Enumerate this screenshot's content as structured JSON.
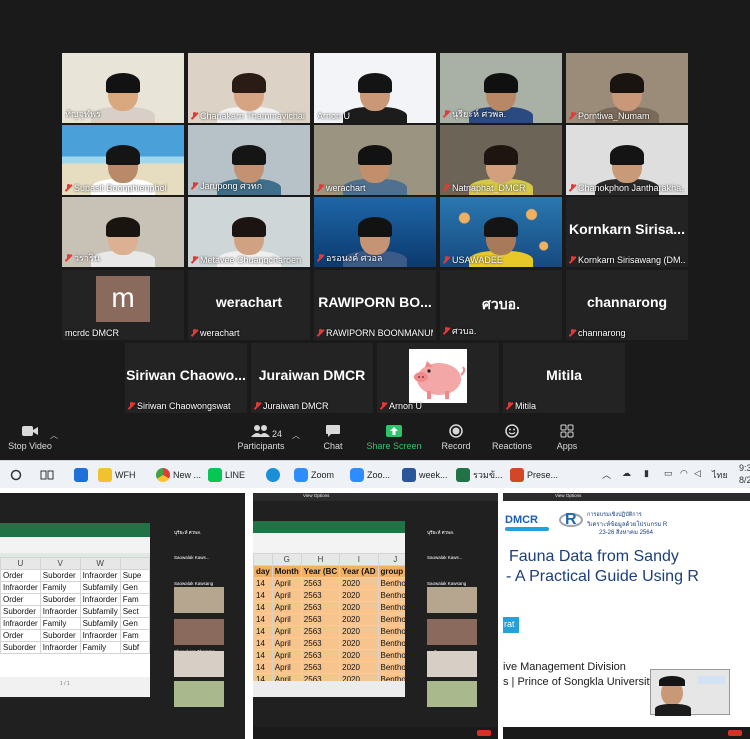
{
  "gallery": {
    "tiles": [
      {
        "name": "ทัญจุฬพร",
        "muted": false,
        "kind": "video",
        "bg": "#e9e4d8",
        "skin": "#d9a87f",
        "hair": "#121212",
        "shirt": "#d8d0c8"
      },
      {
        "name": "Chanakarn Thammavichai",
        "muted": true,
        "kind": "video",
        "bg": "#dcd3c6",
        "skin": "#d6a483",
        "hair": "#2a1c14",
        "shirt": "#f2f2f2"
      },
      {
        "name": "Arnon U",
        "muted": false,
        "kind": "video",
        "bg": "#f2f4f7",
        "skin": "#c99977",
        "hair": "#141414",
        "shirt": "#1c1c1c"
      },
      {
        "name": "นุรียะห์ ศวพล.",
        "muted": true,
        "kind": "video",
        "bg": "#a9b0a6",
        "skin": "#b88866",
        "hair": "#101010",
        "shirt": "#2a4a80"
      },
      {
        "name": "Porntiwa_Numam",
        "muted": true,
        "kind": "video",
        "bg": "#9b8b79",
        "skin": "#c89878",
        "hair": "#1a1410",
        "shirt": "#7a6a5a"
      },
      {
        "name": "Supasit Boonphienphol",
        "muted": true,
        "kind": "beach",
        "bg": "#4aa0d8",
        "skin": "#b88a6a",
        "hair": "#151515",
        "shirt": "#ffffff"
      },
      {
        "name": "Jarupong ศวทก",
        "muted": true,
        "kind": "video",
        "bg": "#b7c2c8",
        "skin": "#c39272",
        "hair": "#151515",
        "shirt": "#3f6f8a"
      },
      {
        "name": "werachart",
        "muted": true,
        "kind": "video",
        "bg": "#9a9480",
        "skin": "#c28f6c",
        "hair": "#121212",
        "shirt": "#507090"
      },
      {
        "name": "Natnaphat_DMCR",
        "muted": true,
        "kind": "video",
        "bg": "#6d6458",
        "skin": "#d2a07c",
        "hair": "#1e1510",
        "shirt": "#d4c84a"
      },
      {
        "name": "Chanokphon Jantharakha...",
        "muted": true,
        "kind": "video",
        "bg": "#dedede",
        "skin": "#c89a78",
        "hair": "#141414",
        "shirt": "#2a2a2a"
      },
      {
        "name": "วราริน",
        "muted": true,
        "kind": "video",
        "bg": "#c7c1b6",
        "skin": "#dcb093",
        "hair": "#1a1410",
        "shirt": "#e8e8e8"
      },
      {
        "name": "Metavee Chuangcharoen",
        "muted": true,
        "kind": "video",
        "bg": "#cfd6d8",
        "skin": "#d1a282",
        "hair": "#1c1410",
        "shirt": "#f0f0f0"
      },
      {
        "name": "อรอนงค์ ศวอล",
        "muted": true,
        "kind": "reef",
        "bg": "#1f66a8",
        "skin": "#c49474",
        "hair": "#121212",
        "shirt": "#3c5a88"
      },
      {
        "name": "USAWADEE",
        "muted": true,
        "kind": "jelly",
        "bg": "#2a77b0",
        "skin": "#a87a5a",
        "hair": "#141414",
        "shirt": "#e8c828"
      },
      {
        "name": "Kornkarn Sirisawang (DM...",
        "muted": true,
        "kind": "text",
        "text": "Kornkarn  Sirisa..."
      },
      {
        "name": "mcrdc DMCR",
        "muted": false,
        "kind": "avatar",
        "letter": "m"
      },
      {
        "name": "werachart",
        "muted": true,
        "kind": "text",
        "text": "werachart"
      },
      {
        "name": "RAWIPORN BOONMANUM",
        "muted": true,
        "kind": "text",
        "text": "RAWIPORN  BO..."
      },
      {
        "name": "ศวบอ.",
        "muted": true,
        "kind": "text",
        "text": "ศวบอ."
      },
      {
        "name": "channarong",
        "muted": true,
        "kind": "text",
        "text": "channarong"
      },
      {
        "name": "Siriwan Chaowongswat",
        "muted": true,
        "kind": "text",
        "text": "Siriwan  Chaowo..."
      },
      {
        "name": "Juraiwan DMCR",
        "muted": true,
        "kind": "text",
        "text": "Juraiwan DMCR"
      },
      {
        "name": "Arnon U",
        "muted": true,
        "kind": "pig"
      },
      {
        "name": "Mitila",
        "muted": true,
        "kind": "text",
        "text": "Mitila"
      }
    ]
  },
  "toolbar": {
    "stop_video": "Stop Video",
    "participants": "Participants",
    "participants_count": "24",
    "chat": "Chat",
    "share_screen": "Share Screen",
    "record": "Record",
    "reactions": "Reactions",
    "apps": "Apps"
  },
  "taskbar": {
    "items": [
      "WFH",
      "New ...",
      "LINE",
      "Zoom",
      "Zoo...",
      "week...",
      "รวมข้...",
      "Prese..."
    ],
    "lang": "ไทย",
    "clock_time": "9:3",
    "clock_date": "8/2"
  },
  "panel1": {
    "columns": [
      "U",
      "V",
      "W"
    ],
    "rows": [
      [
        "Order",
        "Suborder",
        "Infraorder",
        "Supe"
      ],
      [
        "Infraorder",
        "Family",
        "Subfamily",
        "Gen"
      ],
      [
        "Order",
        "Suborder",
        "Infraorder",
        "Fam"
      ],
      [
        "Suborder",
        "Infraorder",
        "Subfamily",
        "Sect"
      ],
      [
        "Infraorder",
        "Family",
        "Subfamily",
        "Gen"
      ],
      [
        "Order",
        "Suborder",
        "Infraorder",
        "Fam"
      ],
      [
        "Suborder",
        "Infraorder",
        "Family",
        "Subf"
      ]
    ],
    "side_names": [
      "นุรียะห์ ศวพล.",
      "Saowalak Kaws...",
      "Saowalak Kawsang",
      "mcrdc DMCR",
      "Chanakarn Thamma..."
    ]
  },
  "panel2": {
    "columns": [
      "G",
      "H",
      "I",
      "J",
      "K"
    ],
    "headers": [
      "day",
      "Month",
      "Year (BC",
      "Year (AD",
      "group",
      "Kin"
    ],
    "rows": [
      [
        "14",
        "April",
        "2563",
        "2020",
        "Benthos",
        "Ani"
      ],
      [
        "14",
        "April",
        "2563",
        "2020",
        "Benthos",
        "Ani"
      ],
      [
        "14",
        "April",
        "2563",
        "2020",
        "Benthos",
        "Ani"
      ],
      [
        "14",
        "April",
        "2563",
        "2020",
        "Benthos",
        "Ani"
      ],
      [
        "14",
        "April",
        "2563",
        "2020",
        "Benthos",
        "Ani"
      ],
      [
        "14",
        "April",
        "2563",
        "2020",
        "Benthos",
        "Ani"
      ],
      [
        "14",
        "April",
        "2563",
        "2020",
        "Benthos",
        "Ani"
      ],
      [
        "14",
        "April",
        "2563",
        "2020",
        "Benthos",
        "Ani"
      ],
      [
        "14",
        "April",
        "2563",
        "2020",
        "Benthos",
        "Ani"
      ]
    ],
    "side_names": [
      "นุรียะห์ ศวพล.",
      "Saowalak Kaws...",
      "Saowalak Kawsang",
      "mcrdc DMCR",
      "วราริน"
    ],
    "view_options": "View Options"
  },
  "panel3": {
    "view_options": "View Options",
    "logo": "DMCR",
    "r_logo": "R",
    "thai_line1": "การอบรมเชิงปฏิบัติการ",
    "thai_line2": "วิเคราะห์ข้อมูลด้วยโปรแกรม R",
    "thai_dates": "23-26 สิงหาคม 2564",
    "title1": "Fauna Data from Sandy",
    "title2": "- A Practical Guide Using R",
    "tag": "rat",
    "footer1": "ive Management Division",
    "footer2": "s | Prince of Songkla University"
  }
}
